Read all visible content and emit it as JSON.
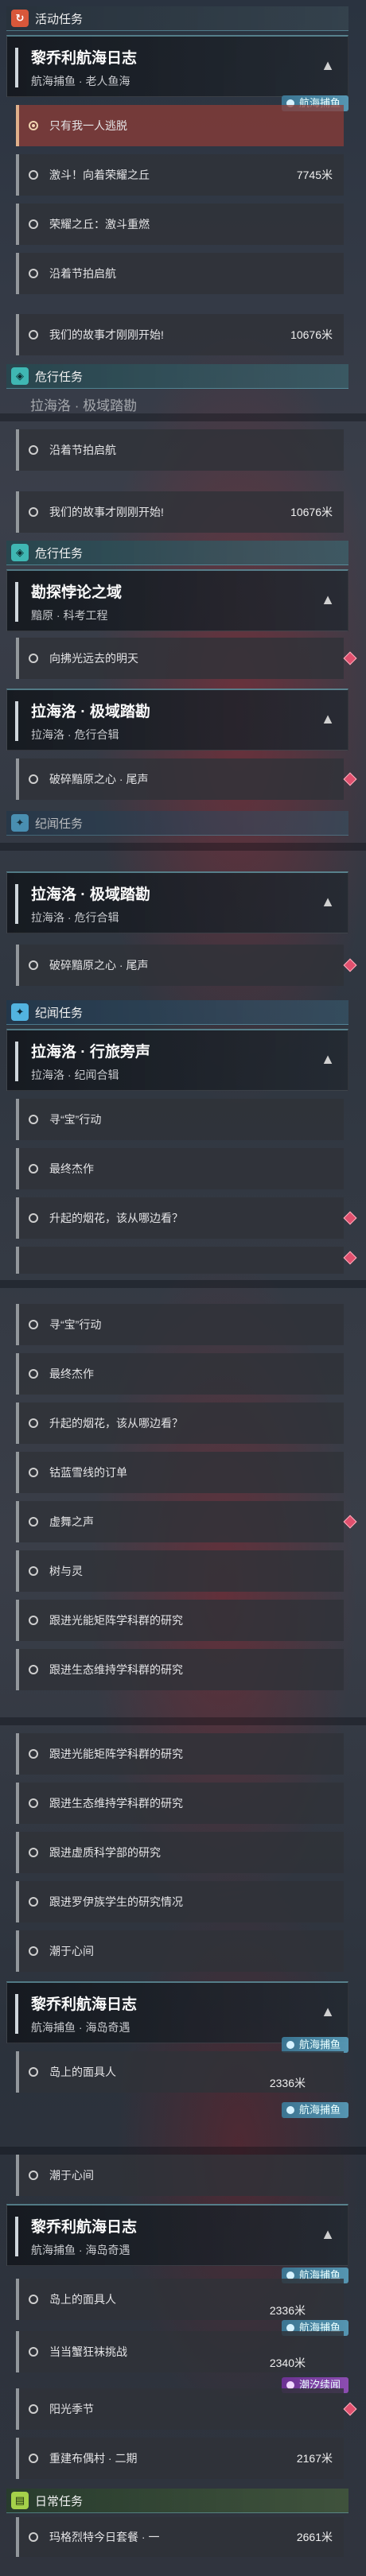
{
  "panel1": {
    "section_activity": "活动任务",
    "head1": {
      "title": "黎乔利航海日志",
      "subtitle": "航海捕鱼 · 老人鱼海",
      "tag": "航海捕鱼"
    },
    "rows": [
      {
        "label": "只有我一人逃脱",
        "distance": ""
      },
      {
        "label": "激斗！向着荣耀之丘",
        "distance": "7745米"
      },
      {
        "label": "荣耀之丘：激斗重燃",
        "distance": ""
      },
      {
        "label": "沿着节拍启航",
        "distance": ""
      },
      {
        "label": "我们的故事才刚刚开始!",
        "distance": "10676米"
      }
    ],
    "section_danger": "危行任务",
    "partial": "拉海洛 · 极域踏勘"
  },
  "panel2": {
    "rows": [
      {
        "label": "沿着节拍启航"
      },
      {
        "label": "我们的故事才刚刚开始!",
        "distance": "10676米"
      }
    ],
    "section_danger": "危行任务",
    "head1": {
      "title": "勘探悖论之域",
      "subtitle": "黯原 · 科考工程"
    },
    "row_a": "向拂光远去的明天",
    "head2": {
      "title": "拉海洛 · 极域踏勘",
      "subtitle": "拉海洛 · 危行合辑"
    },
    "row_b": "破碎黯原之心 · 尾声",
    "section_discipline": "纪闻任务"
  },
  "panel3": {
    "head1": {
      "title": "拉海洛 · 极域踏勘",
      "subtitle": "拉海洛 · 危行合辑"
    },
    "row_a": "破碎黯原之心 · 尾声",
    "section_discipline": "纪闻任务",
    "head2": {
      "title": "拉海洛 · 行旅旁声",
      "subtitle": "拉海洛 · 纪闻合辑"
    },
    "rows": [
      "寻“宝”行动",
      "最终杰作",
      "升起的烟花，该从哪边看？"
    ]
  },
  "panel4": {
    "rows": [
      "寻“宝”行动",
      "最终杰作",
      "升起的烟花，该从哪边看？",
      "钴蓝雪线的订单",
      "虚舞之声",
      "树与灵",
      "跟进光能矩阵学科群的研究",
      "跟进生态维持学科群的研究"
    ]
  },
  "panel5": {
    "rows": [
      "跟进光能矩阵学科群的研究",
      "跟进生态维持学科群的研究",
      "跟进虚质科学部的研究",
      "跟进罗伊族学生的研究情况",
      "潮于心间"
    ],
    "head1": {
      "title": "黎乔利航海日志",
      "subtitle": "航海捕鱼 · 海岛奇遇",
      "tag": "航海捕鱼"
    },
    "row_a": {
      "label": "岛上的面具人",
      "distance": "2336米",
      "tag": "航海捕鱼"
    }
  },
  "panel6": {
    "row_top": "潮于心间",
    "head1": {
      "title": "黎乔利航海日志",
      "subtitle": "航海捕鱼 · 海岛奇遇",
      "tag": "航海捕鱼"
    },
    "rows": [
      {
        "label": "岛上的面具人",
        "distance": "2336米",
        "tag": "航海捕鱼"
      },
      {
        "label": "当当蟹狂袜挑战",
        "distance": "2340米",
        "tag": "潮汐续闻"
      },
      {
        "label": "阳光季节",
        "distance": ""
      },
      {
        "label": "重建布偶村 · 二期",
        "distance": "2167米"
      }
    ],
    "section_daily": "日常任务",
    "row_last": {
      "label": "玛格烈特今日套餐 · 一",
      "distance": "2661米"
    }
  }
}
